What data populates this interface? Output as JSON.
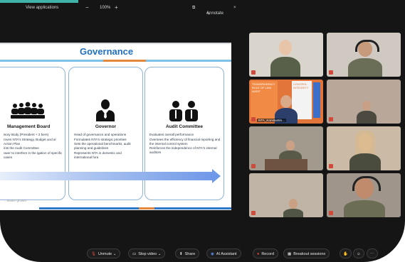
{
  "toolbar": {
    "view_label": "View applications",
    "zoom_minus": "−",
    "zoom_value": "100%",
    "zoom_plus": "+",
    "annotate_label": "Annotate",
    "close_label": "×"
  },
  "slide": {
    "title": "Governance",
    "cards": [
      {
        "title": "Management Board",
        "bullets": [
          "isory Body (President + 2 bers)",
          "roves NTA's Strategy, Budget and al Action Plan",
          "ints the Audit Committee",
          "ower to interfere in the igation of specific cases"
        ]
      },
      {
        "title": "Governor",
        "bullets": [
          "Head of governance and operations",
          "Formulates NTA's strategic priorities",
          "Sets the operational benchmarks, audit planning and guidelines",
          "Represents NTA in domestic and international fora"
        ]
      },
      {
        "title": "Audit Committee",
        "bullets": [
          "Evaluates overall performance",
          "Oversees the efficiency of financial reporting and the internal control system",
          "Reinforces the independence of NTA's internal auditors"
        ]
      }
    ],
    "footer": "...leader growth"
  },
  "participants": [
    {
      "name": ""
    },
    {
      "name": ""
    },
    {
      "name": "NTA_Konstantin..."
    },
    {
      "name": ""
    },
    {
      "name": ""
    },
    {
      "name": ""
    },
    {
      "name": ""
    },
    {
      "name": ""
    }
  ],
  "slide_poster": {
    "left_text": "TRANSPARENCY RULE OF LAW AUDIT",
    "right_text": "CONTROL INTEGRITY"
  },
  "bottom_bar": {
    "unmute": "Unmute",
    "stop_video": "Stop video",
    "share": "Share",
    "ai_assistant": "AI Assistant",
    "record": "Record",
    "breakout": "Breakout sessions"
  },
  "colors": {
    "accent_blue": "#1f6fc0",
    "accent_orange": "#e5873a",
    "teal": "#3fb3a8",
    "dark": "#151515"
  }
}
